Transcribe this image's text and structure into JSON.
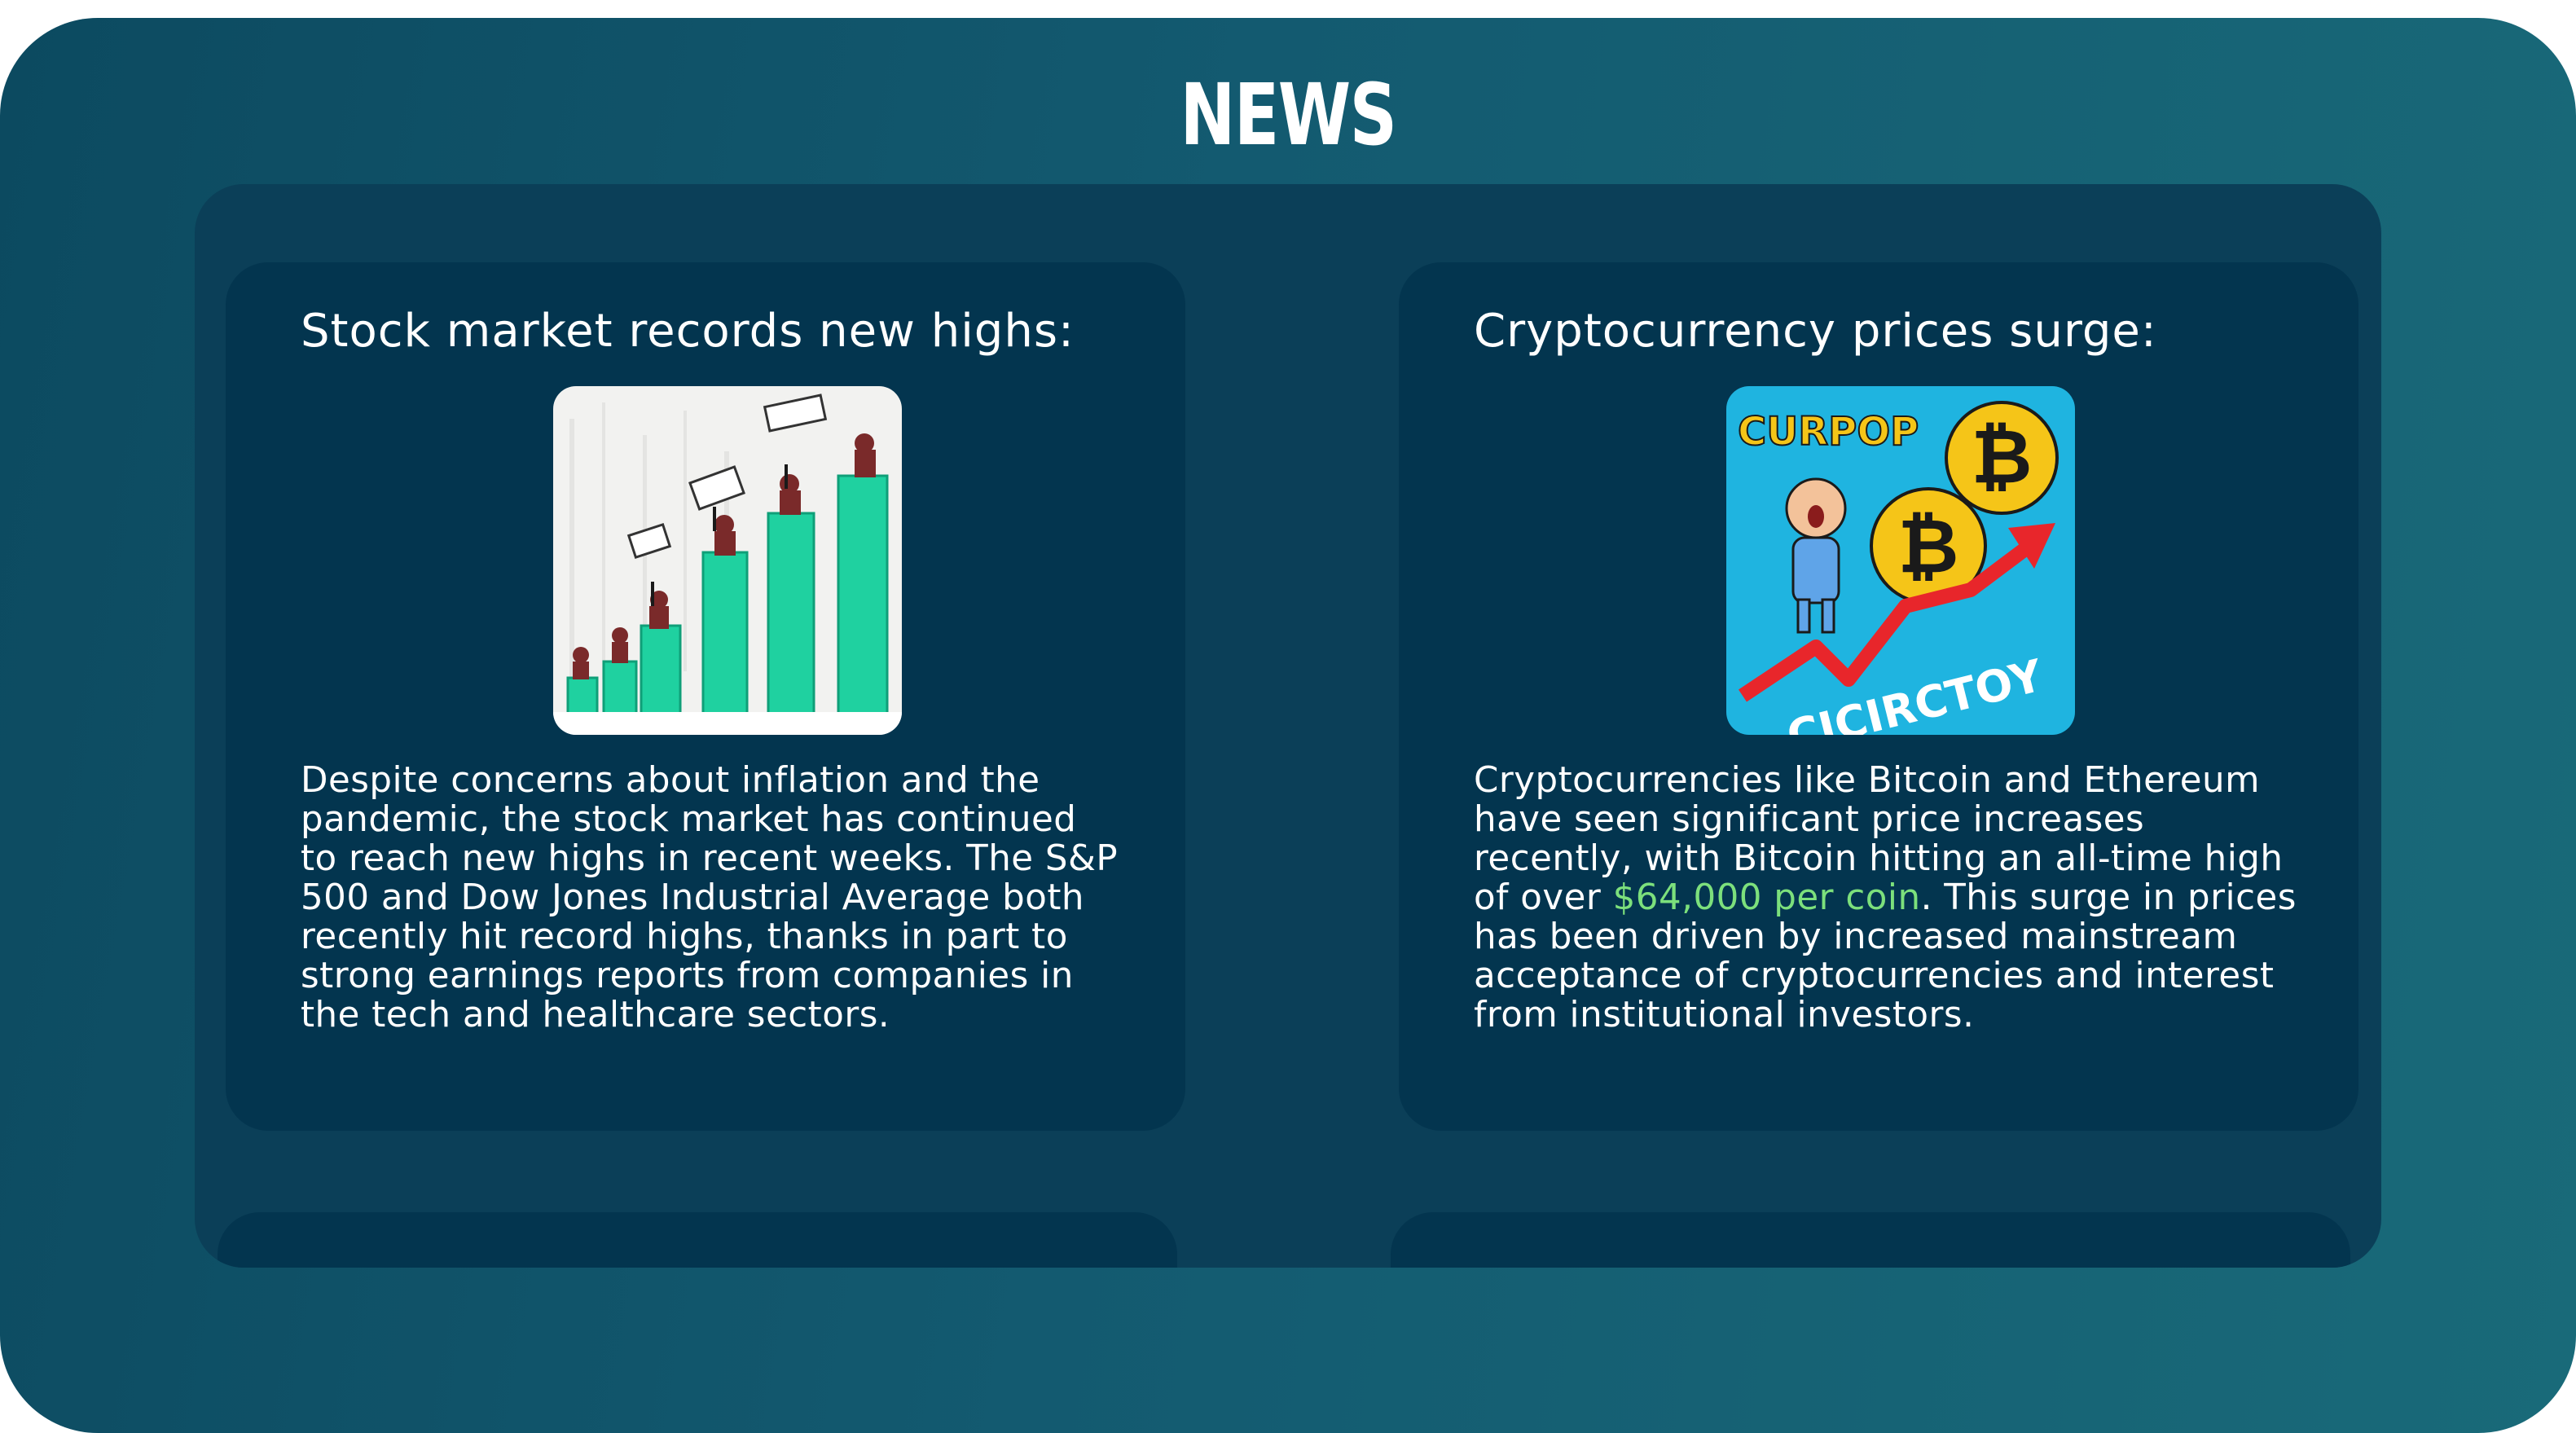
{
  "page": {
    "title": "NEWS"
  },
  "articles": [
    {
      "heading": "Stock market records new highs:",
      "image_icon": "stock-chart-illustration",
      "body": "Despite concerns about inflation and the pandemic, the stock market has continued to reach new highs in recent weeks. The S&P 500 and Dow Jones Industrial Average both recently hit record highs, thanks in part to strong earnings reports from companies in the tech and healthcare sectors."
    },
    {
      "heading": "Cryptocurrency prices surge:",
      "image_icon": "crypto-cartoon-illustration",
      "image_text_top": "CURPOP",
      "image_text_bottom": "CICIRCTOY",
      "image_coin_symbol": "₿",
      "body_before": "Cryptocurrencies like Bitcoin and Ethereum have seen significant price increases recently, with Bitcoin hitting an all-time high of over ",
      "body_highlight": "$64,000 per coin",
      "body_after": ". This surge in prices has been driven by increased mainstream acceptance of cryptocurrencies and interest from institutional investors."
    }
  ],
  "colors": {
    "background_gradient_start": "#0c4a60",
    "background_gradient_end": "#196a79",
    "panel": "#0b3f58",
    "card": "#03354f",
    "text": "#ffffff",
    "highlight": "#7ce07c",
    "chart_bar": "#1fd1a0",
    "crypto_bg": "#1fb4e0",
    "coin": "#f5c518"
  }
}
